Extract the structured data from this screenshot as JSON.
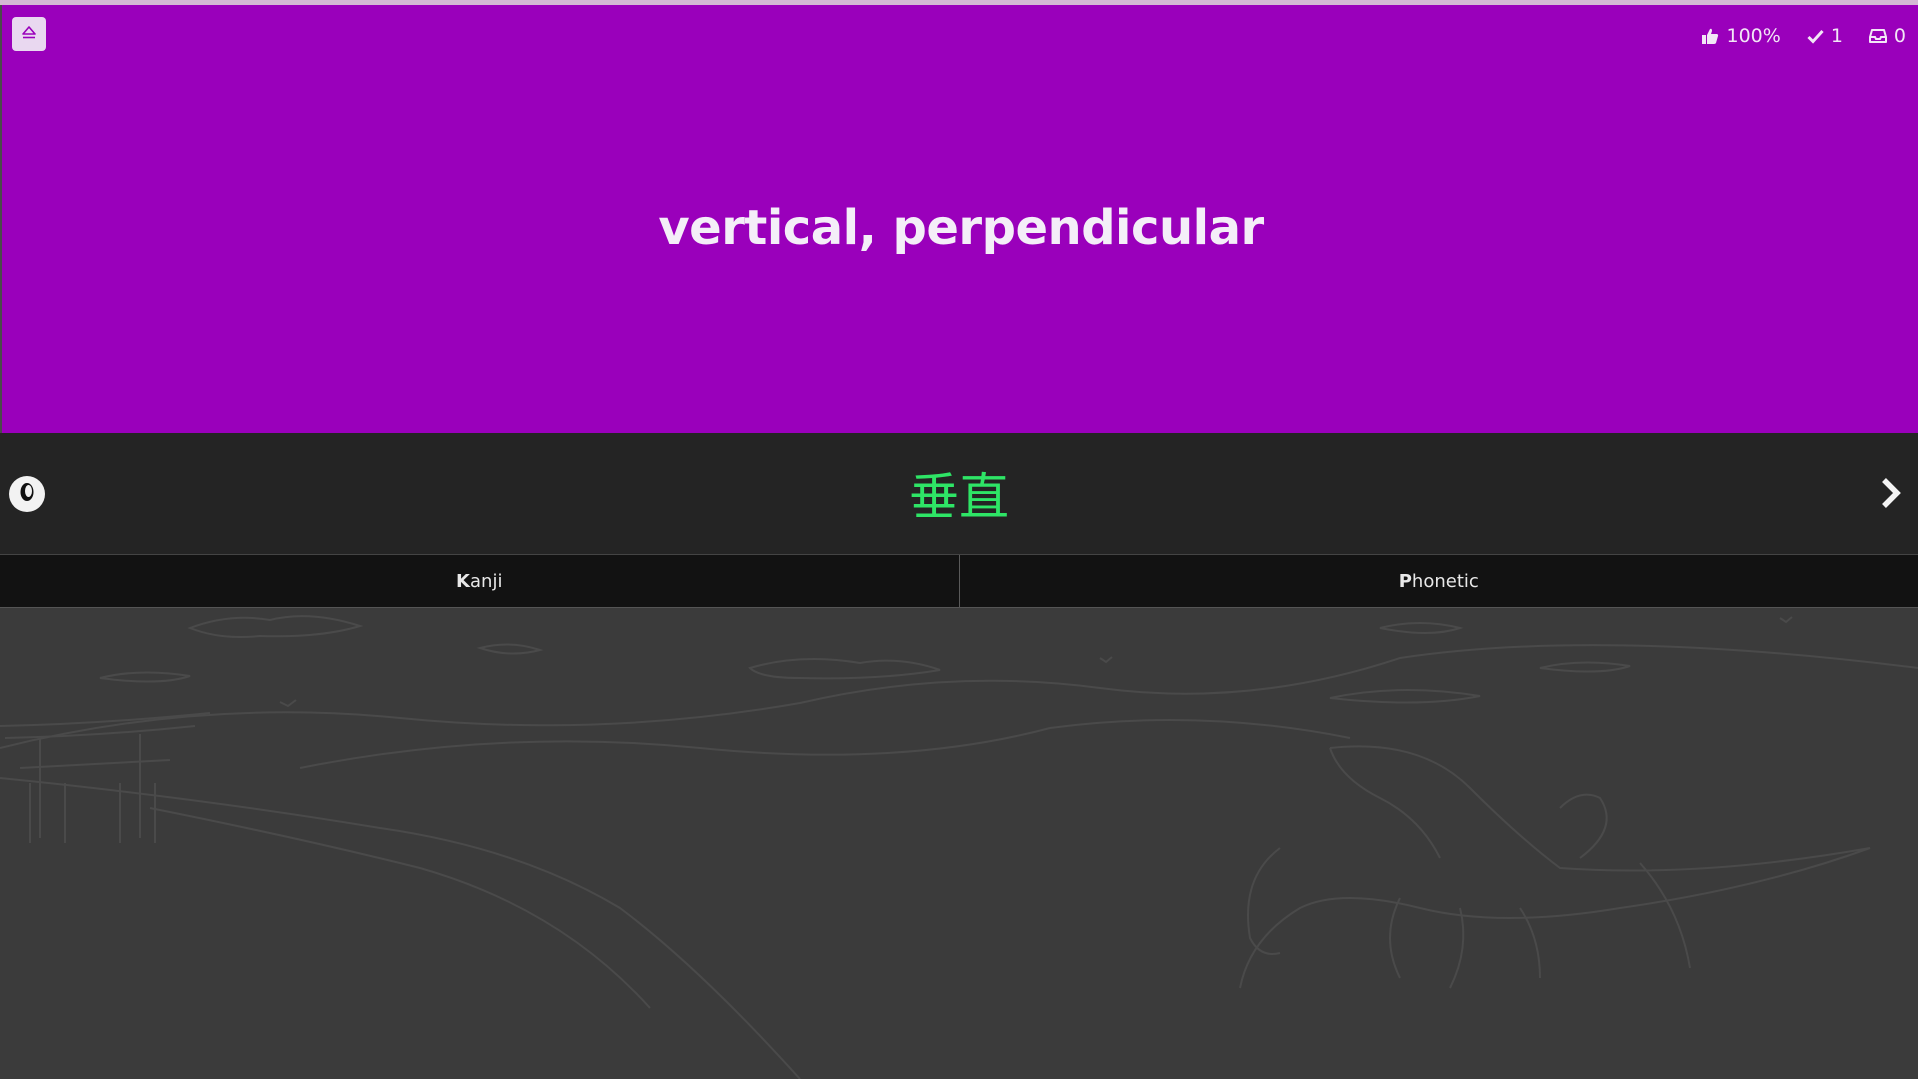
{
  "stats": {
    "accuracy": "100%",
    "correct": "1",
    "remaining": "0"
  },
  "prompt": {
    "meaning": "vertical, perpendicular"
  },
  "answer": {
    "text": "垂直"
  },
  "tabs": [
    {
      "hotkey": "K",
      "rest": "anji"
    },
    {
      "hotkey": "P",
      "rest": "honetic"
    }
  ],
  "colors": {
    "header_bg": "#9a00bb",
    "answer_bg": "#242424",
    "answer_text": "#2ee566",
    "tabs_bg": "#121212",
    "scenery_bg": "#3b3b3b"
  },
  "icons": {
    "menu": "eject-icon",
    "accuracy": "thumbs-up-icon",
    "correct": "checkmark-icon",
    "remaining": "inbox-icon",
    "audio": "audio-play-icon",
    "next": "chevron-right-icon"
  }
}
